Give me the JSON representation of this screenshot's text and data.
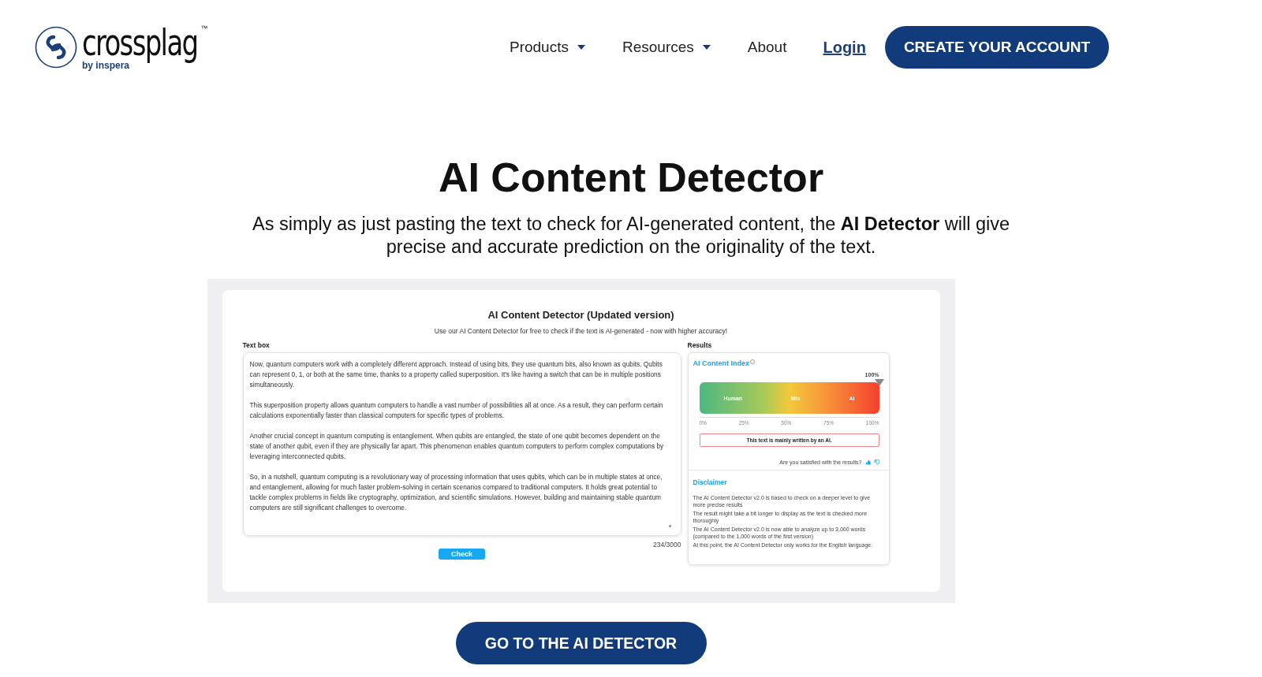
{
  "header": {
    "logo": {
      "wordmark": "crossplag",
      "trademark": "™",
      "byline": "by inspera"
    },
    "nav": [
      {
        "label": "Products",
        "dropdown": true
      },
      {
        "label": "Resources",
        "dropdown": true
      },
      {
        "label": "About",
        "dropdown": false
      }
    ],
    "login": "Login",
    "cta": "CREATE YOUR ACCOUNT"
  },
  "hero": {
    "title": "AI Content Detector",
    "subtitle": "As simply as just pasting the text to check for AI-generated content, the **AI Detector** will give precise and accurate prediction on the originality of the text."
  },
  "preview": {
    "title": "AI Content Detector (Updated version)",
    "subtitle": "Use our AI Content Detector for free to check if the text is AI-generated - now with higher accuracy!",
    "textbox_label": "Text box",
    "paragraphs": [
      "Now, quantum computers work with a completely different approach. Instead of using bits, they use quantum bits, also known as qubits. Qubits can represent 0, 1, or both at the same time, thanks to a property called superposition. It's like having a switch that can be in multiple positions simultaneously.",
      "This superposition property allows quantum computers to handle a vast number of possibilities all at once. As a result, they can perform certain calculations exponentially faster than classical computers for specific types of problems.",
      "Another crucial concept in quantum computing is entanglement. When qubits are entangled, the state of one qubit becomes dependent on the state of another qubit, even if they are physically far apart. This phenomenon enables quantum computers to perform complex computations by leveraging interconnected qubits.",
      "So, in a nutshell, quantum computing is a revolutionary way of processing information that uses qubits, which can be in multiple states at once, and entanglement, allowing for much faster problem-solving in certain scenarios compared to traditional computers. It holds great potential to tackle complex problems in fields like cryptography, optimization, and scientific simulations. However, building and maintaining stable quantum computers are still significant challenges to overcome."
    ],
    "counter": "234/3000",
    "check_button": "Check",
    "results_label": "Results",
    "index_title": "AI Content Index",
    "meter": {
      "reading": "100%",
      "zones": [
        "Human",
        "Mix",
        "AI"
      ],
      "ticks": [
        "0%",
        "25%",
        "50%",
        "75%",
        "100%"
      ]
    },
    "verdict": "This text is mainly written by an AI.",
    "feedback": "Are you satisfied with the results?",
    "disclaimer_title": "Disclaimer",
    "disclaimer": [
      "The AI Content Detector v2.0 is based to check on a deeper level to give more precise results",
      "The result might take a bit longer to display as the text is checked more thoroughly",
      "The AI Content Detector v2.0 is now able to analyze up to 3,000 words (compared to the 1,000 words of the first version)",
      "At this point, the AI Content Detector only works for the English language."
    ]
  },
  "bottom_button": "GO TO THE AI DETECTOR"
}
